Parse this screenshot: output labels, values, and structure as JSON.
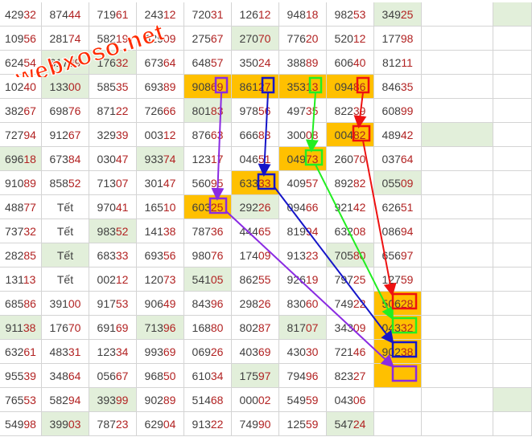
{
  "watermark": "webxoso.net",
  "colors": {
    "green_fill": "#e2efda",
    "orange_fill": "#ffc000",
    "red_digits": "#b22222",
    "grid_line": "#d4d4d4",
    "purple": "#8a2be2",
    "blue": "#1515c8",
    "lime": "#22ee22",
    "red": "#ee1111"
  },
  "rows": [
    [
      {
        "v": "42932"
      },
      {
        "v": "87444"
      },
      {
        "v": "71961"
      },
      {
        "v": "24312"
      },
      {
        "v": "72031"
      },
      {
        "v": "12612"
      },
      {
        "v": "94818"
      },
      {
        "v": "98253"
      },
      {
        "v": "34925",
        "bg": "green"
      },
      {
        "v": ""
      },
      {
        "v": "",
        "bg": "green"
      }
    ],
    [
      {
        "v": "10956"
      },
      {
        "v": "28174"
      },
      {
        "v": "58219"
      },
      {
        "v": "62909"
      },
      {
        "v": "27567"
      },
      {
        "v": "27070",
        "bg": "green"
      },
      {
        "v": "77620"
      },
      {
        "v": "52012"
      },
      {
        "v": "17798"
      },
      {
        "v": ""
      },
      {
        "v": ""
      }
    ],
    [
      {
        "v": "62454"
      },
      {
        "v": "61769",
        "bg": "green"
      },
      {
        "v": "17632",
        "bg": "green"
      },
      {
        "v": "67364"
      },
      {
        "v": "64857"
      },
      {
        "v": "35024"
      },
      {
        "v": "38889"
      },
      {
        "v": "60640"
      },
      {
        "v": "81211"
      },
      {
        "v": ""
      },
      {
        "v": ""
      }
    ],
    [
      {
        "v": "10240"
      },
      {
        "v": "13300",
        "bg": "green"
      },
      {
        "v": "58535"
      },
      {
        "v": "69389"
      },
      {
        "v": "90869",
        "bg": "orange"
      },
      {
        "v": "86127",
        "bg": "orange"
      },
      {
        "v": "35313",
        "bg": "orange"
      },
      {
        "v": "09486",
        "bg": "orange"
      },
      {
        "v": "84635"
      },
      {
        "v": ""
      },
      {
        "v": ""
      }
    ],
    [
      {
        "v": "38267"
      },
      {
        "v": "69876"
      },
      {
        "v": "87122"
      },
      {
        "v": "72666"
      },
      {
        "v": "80183",
        "bg": "green"
      },
      {
        "v": "97856"
      },
      {
        "v": "49735"
      },
      {
        "v": "82239"
      },
      {
        "v": "60899"
      },
      {
        "v": ""
      },
      {
        "v": ""
      }
    ],
    [
      {
        "v": "72794"
      },
      {
        "v": "91267"
      },
      {
        "v": "32939"
      },
      {
        "v": "00312"
      },
      {
        "v": "87663"
      },
      {
        "v": "66683"
      },
      {
        "v": "30008"
      },
      {
        "v": "00482",
        "bg": "orange"
      },
      {
        "v": "48942"
      },
      {
        "v": "",
        "bg": "green"
      },
      {
        "v": ""
      }
    ],
    [
      {
        "v": "69618",
        "bg": "green"
      },
      {
        "v": "67384"
      },
      {
        "v": "03047"
      },
      {
        "v": "93374",
        "bg": "green"
      },
      {
        "v": "12317"
      },
      {
        "v": "04651"
      },
      {
        "v": "04973",
        "bg": "orange"
      },
      {
        "v": "26070"
      },
      {
        "v": "03764"
      },
      {
        "v": ""
      },
      {
        "v": ""
      }
    ],
    [
      {
        "v": "91089"
      },
      {
        "v": "85852"
      },
      {
        "v": "71307"
      },
      {
        "v": "30147"
      },
      {
        "v": "56095"
      },
      {
        "v": "63333",
        "bg": "orange"
      },
      {
        "v": "40957"
      },
      {
        "v": "89282"
      },
      {
        "v": "05509",
        "bg": "green"
      },
      {
        "v": ""
      },
      {
        "v": ""
      }
    ],
    [
      {
        "v": "48877"
      },
      {
        "v": "Tết"
      },
      {
        "v": "97041"
      },
      {
        "v": "16510"
      },
      {
        "v": "60325",
        "bg": "orange"
      },
      {
        "v": "29226",
        "bg": "green"
      },
      {
        "v": "09466"
      },
      {
        "v": "92142"
      },
      {
        "v": "62651"
      },
      {
        "v": ""
      },
      {
        "v": ""
      }
    ],
    [
      {
        "v": "73732"
      },
      {
        "v": "Tết"
      },
      {
        "v": "98352",
        "bg": "green"
      },
      {
        "v": "14138"
      },
      {
        "v": "78736"
      },
      {
        "v": "44465"
      },
      {
        "v": "81994"
      },
      {
        "v": "63208"
      },
      {
        "v": "08694"
      },
      {
        "v": ""
      },
      {
        "v": ""
      }
    ],
    [
      {
        "v": "28285"
      },
      {
        "v": "Tết",
        "bg": "green"
      },
      {
        "v": "68333"
      },
      {
        "v": "69356"
      },
      {
        "v": "98076"
      },
      {
        "v": "17409"
      },
      {
        "v": "91323"
      },
      {
        "v": "70580",
        "bg": "green"
      },
      {
        "v": "65697"
      },
      {
        "v": ""
      },
      {
        "v": ""
      }
    ],
    [
      {
        "v": "13113"
      },
      {
        "v": "Tết"
      },
      {
        "v": "00212"
      },
      {
        "v": "12073"
      },
      {
        "v": "54105",
        "bg": "green"
      },
      {
        "v": "86255"
      },
      {
        "v": "92619"
      },
      {
        "v": "79725"
      },
      {
        "v": "12759"
      },
      {
        "v": ""
      },
      {
        "v": ""
      }
    ],
    [
      {
        "v": "68586"
      },
      {
        "v": "39100"
      },
      {
        "v": "91753"
      },
      {
        "v": "90649"
      },
      {
        "v": "84396"
      },
      {
        "v": "29826"
      },
      {
        "v": "83060"
      },
      {
        "v": "74922"
      },
      {
        "v": "50628",
        "bg": "orange"
      },
      {
        "v": ""
      },
      {
        "v": ""
      }
    ],
    [
      {
        "v": "91138",
        "bg": "green"
      },
      {
        "v": "17670"
      },
      {
        "v": "69169"
      },
      {
        "v": "71396",
        "bg": "green"
      },
      {
        "v": "16880"
      },
      {
        "v": "80287"
      },
      {
        "v": "81707",
        "bg": "green"
      },
      {
        "v": "34309"
      },
      {
        "v": "04332",
        "bg": "orange"
      },
      {
        "v": ""
      },
      {
        "v": ""
      }
    ],
    [
      {
        "v": "63261"
      },
      {
        "v": "48331"
      },
      {
        "v": "12334"
      },
      {
        "v": "99369"
      },
      {
        "v": "06926"
      },
      {
        "v": "40369"
      },
      {
        "v": "43030"
      },
      {
        "v": "72146"
      },
      {
        "v": "90238",
        "bg": "orange"
      },
      {
        "v": ""
      },
      {
        "v": ""
      }
    ],
    [
      {
        "v": "95539"
      },
      {
        "v": "34864"
      },
      {
        "v": "05667"
      },
      {
        "v": "96850"
      },
      {
        "v": "61034"
      },
      {
        "v": "17597",
        "bg": "green"
      },
      {
        "v": "79496"
      },
      {
        "v": "82327"
      },
      {
        "v": "",
        "bg": "orange"
      },
      {
        "v": ""
      },
      {
        "v": ""
      }
    ],
    [
      {
        "v": "76553"
      },
      {
        "v": "58294"
      },
      {
        "v": "39399",
        "bg": "green"
      },
      {
        "v": "90289"
      },
      {
        "v": "51468"
      },
      {
        "v": "00002"
      },
      {
        "v": "54959"
      },
      {
        "v": "04306"
      },
      {
        "v": ""
      },
      {
        "v": ""
      },
      {
        "v": "",
        "bg": "green"
      }
    ],
    [
      {
        "v": "54998"
      },
      {
        "v": "39903",
        "bg": "green"
      },
      {
        "v": "78723"
      },
      {
        "v": "62904"
      },
      {
        "v": "91322"
      },
      {
        "v": "74990"
      },
      {
        "v": "12559"
      },
      {
        "v": "54724",
        "bg": "green"
      },
      {
        "v": ""
      },
      {
        "v": ""
      },
      {
        "v": ""
      }
    ]
  ]
}
